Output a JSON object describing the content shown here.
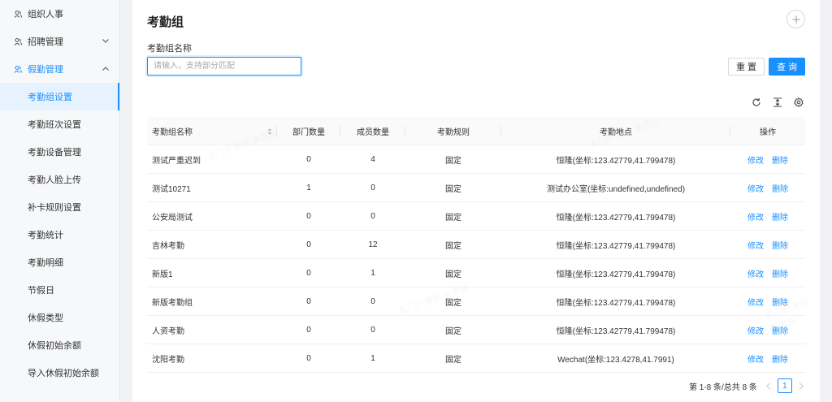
{
  "sidebar": {
    "groups": [
      {
        "label": "组织人事",
        "icon": "user-group-icon",
        "expanded": false
      },
      {
        "label": "招聘管理",
        "icon": "user-group-icon",
        "expanded": false
      },
      {
        "label": "假勤管理",
        "icon": "user-group-icon",
        "expanded": true
      }
    ],
    "items": [
      {
        "label": "考勤组设置",
        "selected": true
      },
      {
        "label": "考勤班次设置"
      },
      {
        "label": "考勤设备管理"
      },
      {
        "label": "考勤人脸上传"
      },
      {
        "label": "补卡规则设置"
      },
      {
        "label": "考勤统计"
      },
      {
        "label": "考勤明细"
      },
      {
        "label": "节假日"
      },
      {
        "label": "休假类型"
      },
      {
        "label": "休假初始余额"
      },
      {
        "label": "导入休假初始余额"
      }
    ]
  },
  "page": {
    "title": "考勤组",
    "field_label": "考勤组名称",
    "search_placeholder": "请输入，支持部分匹配",
    "reset_label": "重 置",
    "query_label": "查 询"
  },
  "table": {
    "headers": [
      "考勤组名称",
      "部门数量",
      "成员数量",
      "考勤规则",
      "考勤地点",
      "操作"
    ],
    "rows": [
      {
        "name": "测试严重迟到",
        "depts": "0",
        "members": "4",
        "rule": "固定",
        "location": "恒隆(坐标:123.42779,41.799478)"
      },
      {
        "name": "测试10271",
        "depts": "1",
        "members": "0",
        "rule": "固定",
        "location": "测试办公室(坐标:undefined,undefined)"
      },
      {
        "name": "公安局测试",
        "depts": "0",
        "members": "0",
        "rule": "固定",
        "location": "恒隆(坐标:123.42779,41.799478)"
      },
      {
        "name": "吉林考勤",
        "depts": "0",
        "members": "12",
        "rule": "固定",
        "location": "恒隆(坐标:123.42779,41.799478)"
      },
      {
        "name": "新版1",
        "depts": "0",
        "members": "1",
        "rule": "固定",
        "location": "恒隆(坐标:123.42779,41.799478)"
      },
      {
        "name": "新版考勤组",
        "depts": "0",
        "members": "0",
        "rule": "固定",
        "location": "恒隆(坐标:123.42779,41.799478)"
      },
      {
        "name": "人资考勤",
        "depts": "0",
        "members": "0",
        "rule": "固定",
        "location": "恒隆(坐标:123.42779,41.799478)"
      },
      {
        "name": "沈阳考勤",
        "depts": "0",
        "members": "1",
        "rule": "固定",
        "location": "Wechat(坐标:123.4278,41.7991)"
      }
    ],
    "edit_label": "修改",
    "delete_label": "删除"
  },
  "pagination": {
    "summary": "第 1-8 条/总共 8 条",
    "current_page": "1"
  },
  "watermark": "五门户演示 张思远",
  "colors": {
    "accent": "#1890ff",
    "sidebar_bg": "#f7f8fa",
    "selected_bg": "#e6f3ff"
  }
}
